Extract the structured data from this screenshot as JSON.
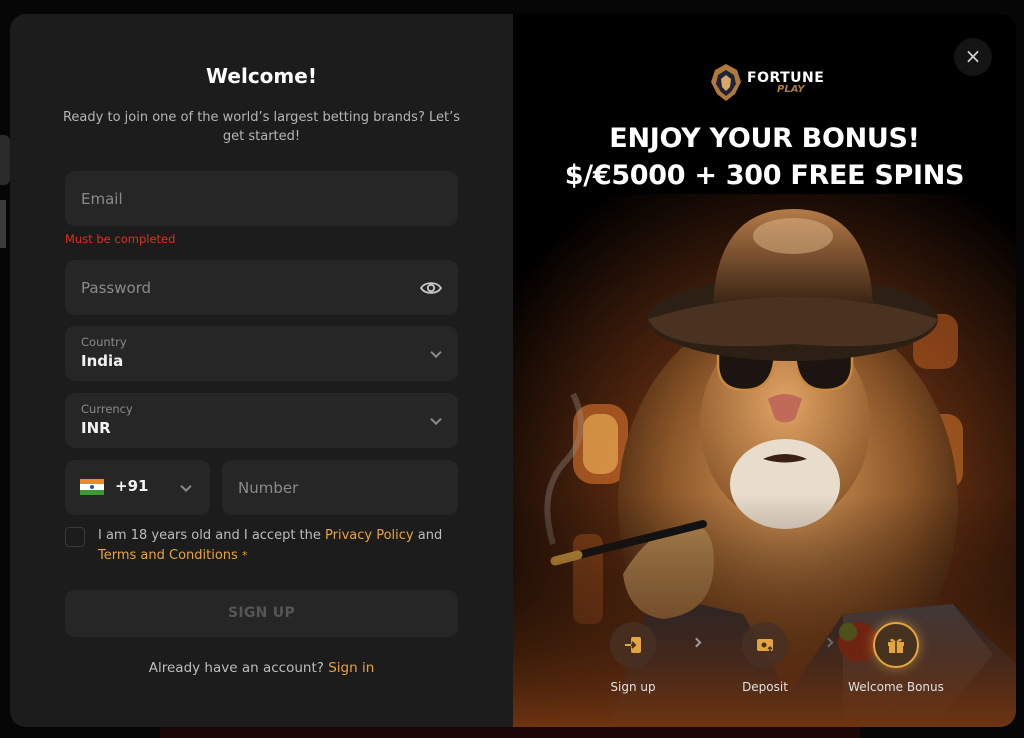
{
  "form": {
    "title": "Welcome!",
    "subtitle": "Ready to join one of the world’s largest betting brands? Let’s get started!",
    "email": {
      "placeholder": "Email",
      "error": "Must be completed"
    },
    "password": {
      "placeholder": "Password",
      "toggle_icon": "eye-icon"
    },
    "country": {
      "label": "Country",
      "value": "India"
    },
    "currency": {
      "label": "Currency",
      "value": "INR"
    },
    "phone": {
      "code": "+91",
      "flag": "india-flag",
      "placeholder": "Number"
    },
    "agree": {
      "text_before": "I am 18 years old and I accept the ",
      "privacy_link": "Privacy Policy",
      "text_middle": " and ",
      "terms_link": "Terms and Conditions",
      "required_mark": "*",
      "checked": false
    },
    "signup_label": "SIGN UP",
    "already_text": "Already have an account?",
    "signin_link": "Sign in"
  },
  "promo": {
    "brand": "FORTUNE",
    "brand_sub": "PLAY",
    "headline_line1": "ENJOY YOUR BONUS!",
    "headline_line2": "$/€5000 + 300 FREE SPINS",
    "close_label": "×",
    "steps": [
      {
        "label": "Sign up",
        "icon": "sign-in-icon",
        "active": false
      },
      {
        "label": "Deposit",
        "icon": "wallet-icon",
        "active": false
      },
      {
        "label": "Welcome Bonus",
        "icon": "gift-icon",
        "active": true
      }
    ]
  },
  "colors": {
    "accent": "#e9a43a",
    "error": "#e0301e",
    "panel": "#1c1c1c",
    "field": "#262626"
  }
}
